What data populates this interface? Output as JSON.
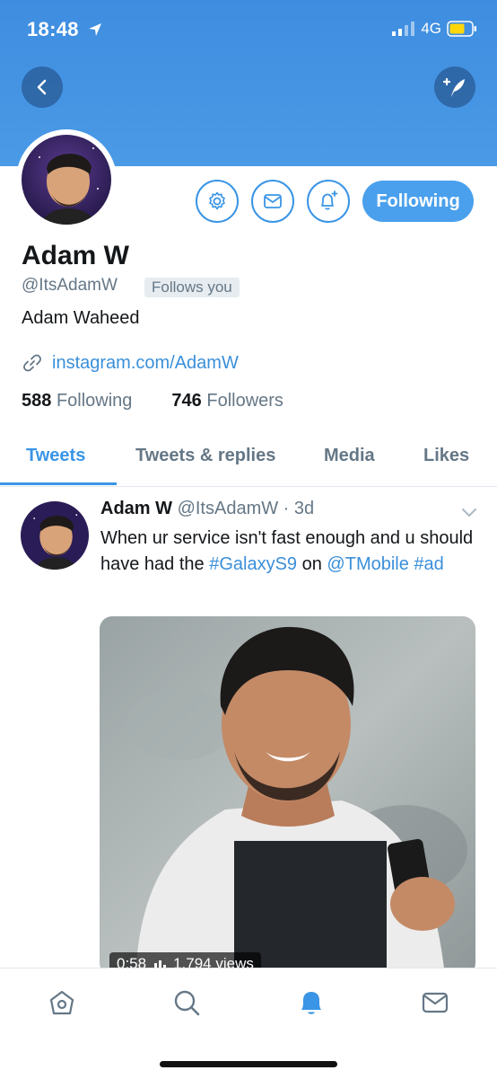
{
  "status_bar": {
    "time": "18:48",
    "network": "4G"
  },
  "profile": {
    "name": "Adam W",
    "handle": "@ItsAdamW",
    "follows_you": "Follows you",
    "bio": "Adam Waheed",
    "link": "instagram.com/AdamW",
    "following_count": "588",
    "following_label": "Following",
    "followers_count": "746",
    "followers_label": "Followers",
    "follow_button_label": "Following"
  },
  "tabs": [
    {
      "label": "Tweets",
      "active": true
    },
    {
      "label": "Tweets & replies",
      "active": false
    },
    {
      "label": "Media",
      "active": false
    },
    {
      "label": "Likes",
      "active": false
    }
  ],
  "tweet": {
    "name": "Adam W",
    "handle": "@ItsAdamW",
    "separator": " · ",
    "time": "3d",
    "text_1": "When ur service isn't fast enough and u should have had the ",
    "hashtag_1": "#GalaxyS9",
    "text_2": " on ",
    "mention": "@TMobile",
    "text_3": " ",
    "hashtag_2": "#ad",
    "video_duration": "0:58",
    "video_views": "1,794 views"
  },
  "bottom_nav": [
    "home-icon",
    "search-icon",
    "notifications-icon",
    "messages-icon"
  ],
  "colors": {
    "accent": "#4aa0ec",
    "link": "#3a8fd9",
    "header": "#4a9ae6",
    "secondary_text": "#657786"
  }
}
